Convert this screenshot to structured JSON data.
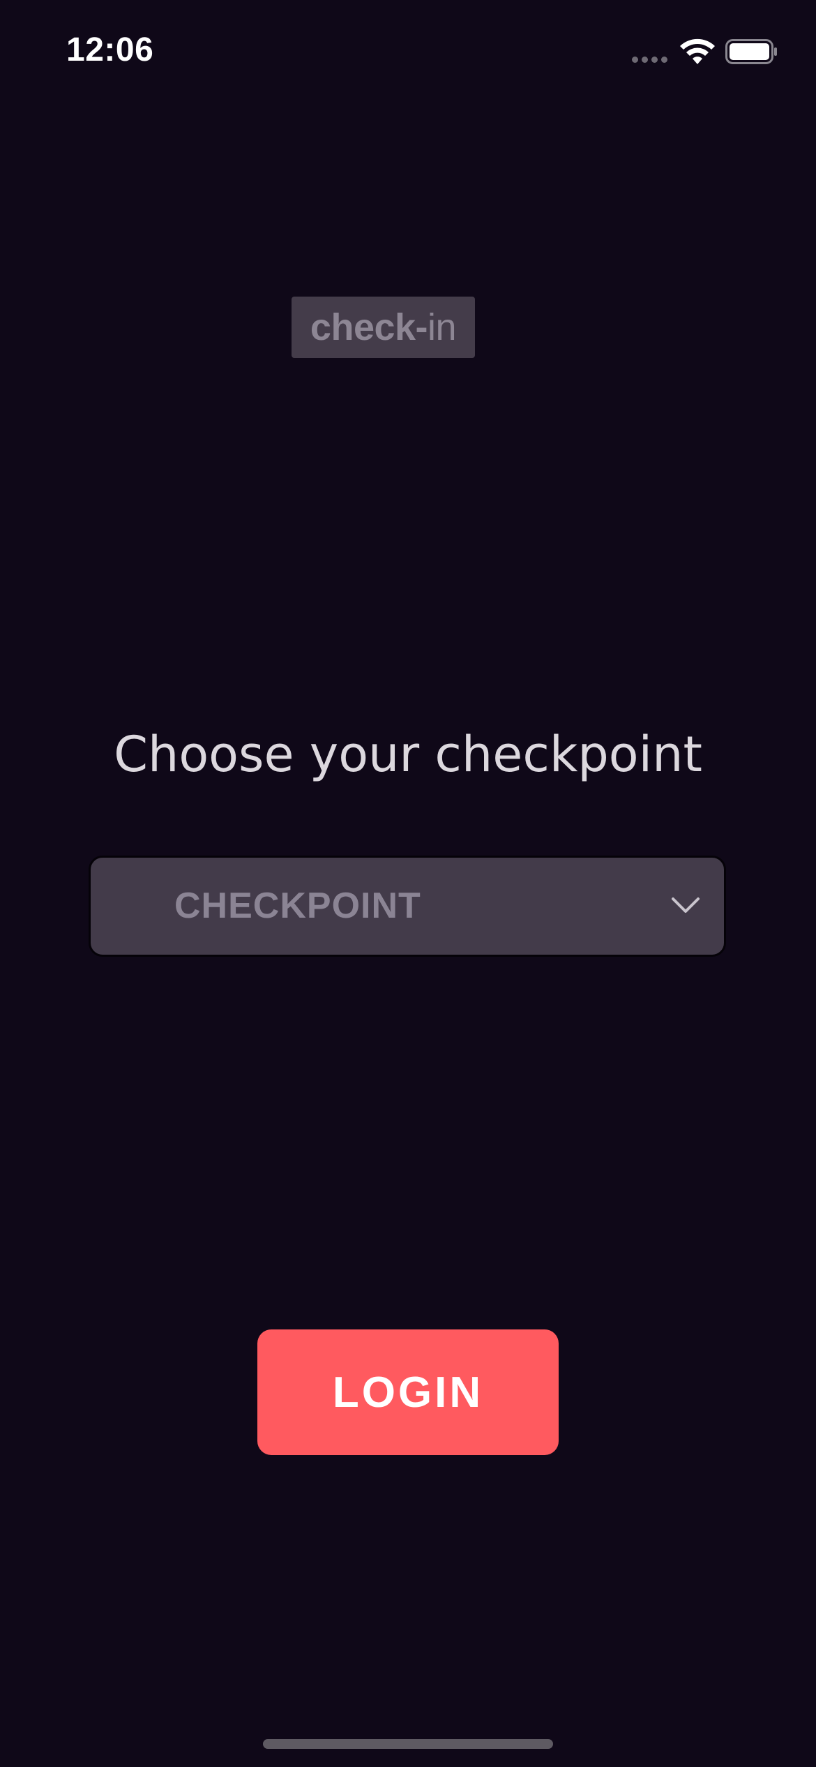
{
  "status_bar": {
    "time": "12:06",
    "icons": [
      "signal-dots-icon",
      "wifi-icon",
      "battery-icon"
    ]
  },
  "logo": {
    "bold_text": "check-",
    "light_text": "in"
  },
  "heading": "Choose your checkpoint",
  "checkpoint_select": {
    "placeholder": "CHECKPOINT",
    "icon": "chevron-down-icon"
  },
  "login_button": {
    "label": "LOGIN"
  },
  "colors": {
    "background": "#0f0818",
    "field": "#433b4a",
    "accent": "#ff5a5f",
    "placeholder": "#8b8494",
    "heading": "#dcd8de"
  }
}
